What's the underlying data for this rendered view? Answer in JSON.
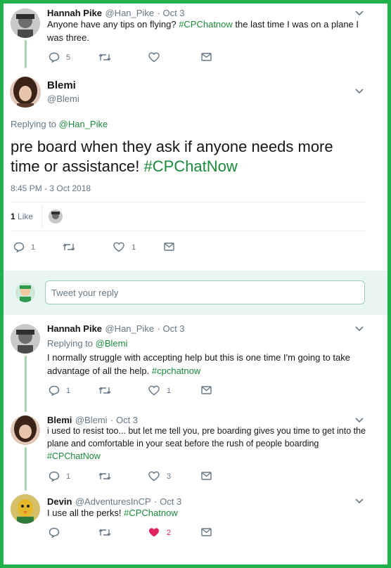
{
  "tweet1": {
    "name": "Hannah Pike",
    "handle": "@Han_Pike",
    "date": "· Oct 3",
    "text_a": "Anyone have any tips on flying?  ",
    "tag": "#CPChatnow",
    "text_b": " the last time I was on a plane I was three.",
    "reply_count": "5"
  },
  "main": {
    "name": "Blemi",
    "handle": "@Blemi",
    "replying_prefix": "Replying to ",
    "replying_to": "@Han_Pike",
    "text_a": "pre board when they ask if anyone needs more time or assistance! ",
    "tag": "#CPChatNow",
    "timestamp": "8:45 PM - 3 Oct 2018",
    "likes_count": "1",
    "likes_label": "Like",
    "reply_count": "1",
    "like_count": "1"
  },
  "compose": {
    "placeholder": "Tweet your reply"
  },
  "reply1": {
    "name": "Hannah Pike",
    "handle": "@Han_Pike",
    "date": "· Oct 3",
    "replying_prefix": "Replying to ",
    "replying_to": "@Blemi",
    "text_a": "I normally struggle with accepting help but this is one time I'm going to take advantage of all the help. ",
    "tag": "#cpchatnow",
    "reply_count": "1",
    "like_count": "1"
  },
  "reply2": {
    "name": "Blemi",
    "handle": "@Blemi",
    "date": "· Oct 3",
    "text_a": "i used to resist too... but let me tell you, pre boarding gives you time to get into the plane and comfortable in your seat before the rush of people boarding ",
    "tag": "#CPChatNow",
    "reply_count": "1",
    "like_count": "3"
  },
  "reply3": {
    "name": "Devin",
    "handle": "@AdventuresInCP",
    "date": "· Oct 3",
    "text_a": "I use all the perks! ",
    "tag": "#CPChatnow",
    "like_count": "2"
  },
  "colors": {
    "accent": "#1a8a3a",
    "border": "#20b24a",
    "liked": "#e0245e"
  }
}
